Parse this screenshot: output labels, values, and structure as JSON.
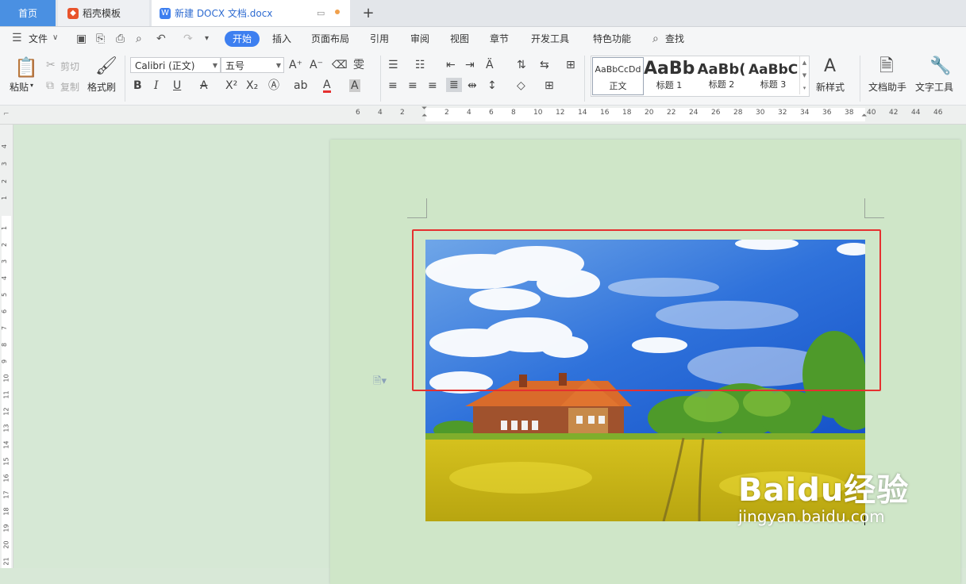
{
  "tabs": {
    "home": "首页",
    "template": "稻壳模板",
    "document": "新建 DOCX 文档.docx"
  },
  "menu": {
    "file": "文件",
    "items": [
      "开始",
      "插入",
      "页面布局",
      "引用",
      "审阅",
      "视图",
      "章节",
      "开发工具",
      "特色功能"
    ],
    "search": "查找"
  },
  "clipboard": {
    "paste": "粘贴",
    "cut": "剪切",
    "copy": "复制",
    "format_painter": "格式刷"
  },
  "font": {
    "name": "Calibri (正文)",
    "size": "五号"
  },
  "styles": [
    {
      "preview": "AaBbCcDd",
      "label": "正文"
    },
    {
      "preview": "AaBb",
      "label": "标题 1"
    },
    {
      "preview": "AaBb(",
      "label": "标题 2"
    },
    {
      "preview": "AaBbC(",
      "label": "标题 3"
    }
  ],
  "right_tools": {
    "new_style": "新样式",
    "doc_assistant": "文档助手",
    "text_tools": "文字工具"
  },
  "ruler_h": [
    "6",
    "4",
    "2",
    "2",
    "4",
    "6",
    "8",
    "10",
    "12",
    "14",
    "16",
    "18",
    "20",
    "22",
    "24",
    "26",
    "28",
    "30",
    "32",
    "34",
    "36",
    "38",
    "40",
    "42",
    "44",
    "46"
  ],
  "ruler_v": [
    "4",
    "3",
    "2",
    "1",
    "1",
    "2",
    "3",
    "4",
    "5",
    "6",
    "7",
    "8",
    "9",
    "10",
    "11",
    "12",
    "13",
    "14",
    "15",
    "16",
    "17",
    "18",
    "19",
    "20",
    "21"
  ],
  "watermark": {
    "main": "Baidu经验",
    "sub": "jingyan.baidu.com"
  },
  "colors": {
    "accent": "#3d7ff0",
    "highlight": "#e53030",
    "page_bg": "#cfe6c8"
  }
}
